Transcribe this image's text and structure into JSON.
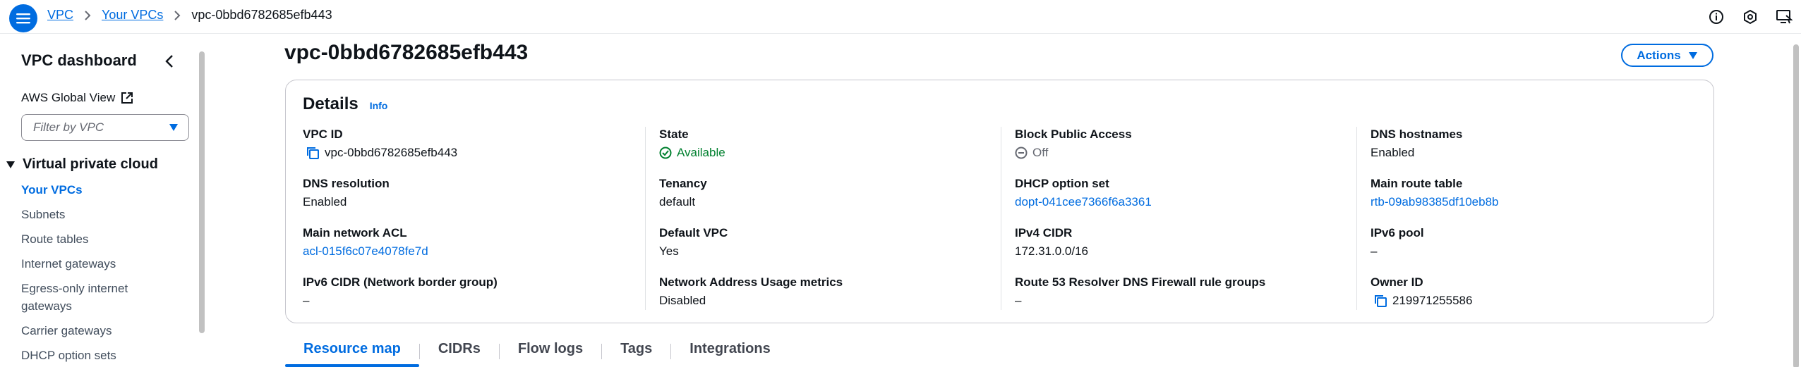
{
  "breadcrumb": {
    "items": [
      "VPC",
      "Your VPCs"
    ],
    "current": "vpc-0bbd6782685efb443"
  },
  "top_icons": [
    "info-circle-icon",
    "settings-hex-icon",
    "screen-feedback-icon"
  ],
  "sidebar": {
    "title": "VPC dashboard",
    "global_view": "AWS Global View",
    "filter_placeholder": "Filter by VPC",
    "section": "Virtual private cloud",
    "items": [
      {
        "label": "Your VPCs",
        "active": true
      },
      {
        "label": "Subnets"
      },
      {
        "label": "Route tables"
      },
      {
        "label": "Internet gateways"
      },
      {
        "label": "Egress-only internet gateways"
      },
      {
        "label": "Carrier gateways"
      },
      {
        "label": "DHCP option sets"
      }
    ]
  },
  "page": {
    "title": "vpc-0bbd6782685efb443",
    "actions_label": "Actions"
  },
  "details": {
    "title": "Details",
    "info_label": "Info",
    "columns": [
      [
        {
          "label": "VPC ID",
          "value": "vpc-0bbd6782685efb443",
          "icon": "copy-icon"
        },
        {
          "label": "DNS resolution",
          "value": "Enabled"
        },
        {
          "label": "Main network ACL",
          "value": "acl-015f6c07e4078fe7d",
          "link": true
        },
        {
          "label": "IPv6 CIDR (Network border group)",
          "value": "–"
        }
      ],
      [
        {
          "label": "State",
          "value": "Available",
          "icon": "check-circle-icon",
          "status": "success"
        },
        {
          "label": "Tenancy",
          "value": "default"
        },
        {
          "label": "Default VPC",
          "value": "Yes"
        },
        {
          "label": "Network Address Usage metrics",
          "value": "Disabled"
        }
      ],
      [
        {
          "label": "Block Public Access",
          "value": "Off",
          "icon": "minus-circle-icon",
          "status": "muted"
        },
        {
          "label": "DHCP option set",
          "value": "dopt-041cee7366f6a3361",
          "link": true
        },
        {
          "label": "IPv4 CIDR",
          "value": "172.31.0.0/16"
        },
        {
          "label": "Route 53 Resolver DNS Firewall rule groups",
          "value": "–"
        }
      ],
      [
        {
          "label": "DNS hostnames",
          "value": "Enabled"
        },
        {
          "label": "Main route table",
          "value": "rtb-09ab98385df10eb8b",
          "link": true
        },
        {
          "label": "IPv6 pool",
          "value": "–"
        },
        {
          "label": "Owner ID",
          "value": "219971255586",
          "icon": "copy-icon"
        }
      ]
    ]
  },
  "tabs": [
    {
      "label": "Resource map",
      "active": true
    },
    {
      "label": "CIDRs"
    },
    {
      "label": "Flow logs"
    },
    {
      "label": "Tags"
    },
    {
      "label": "Integrations"
    }
  ],
  "colors": {
    "accent": "#006ce0",
    "success": "#00802f",
    "text": "#0f141a",
    "muted": "#656871"
  }
}
